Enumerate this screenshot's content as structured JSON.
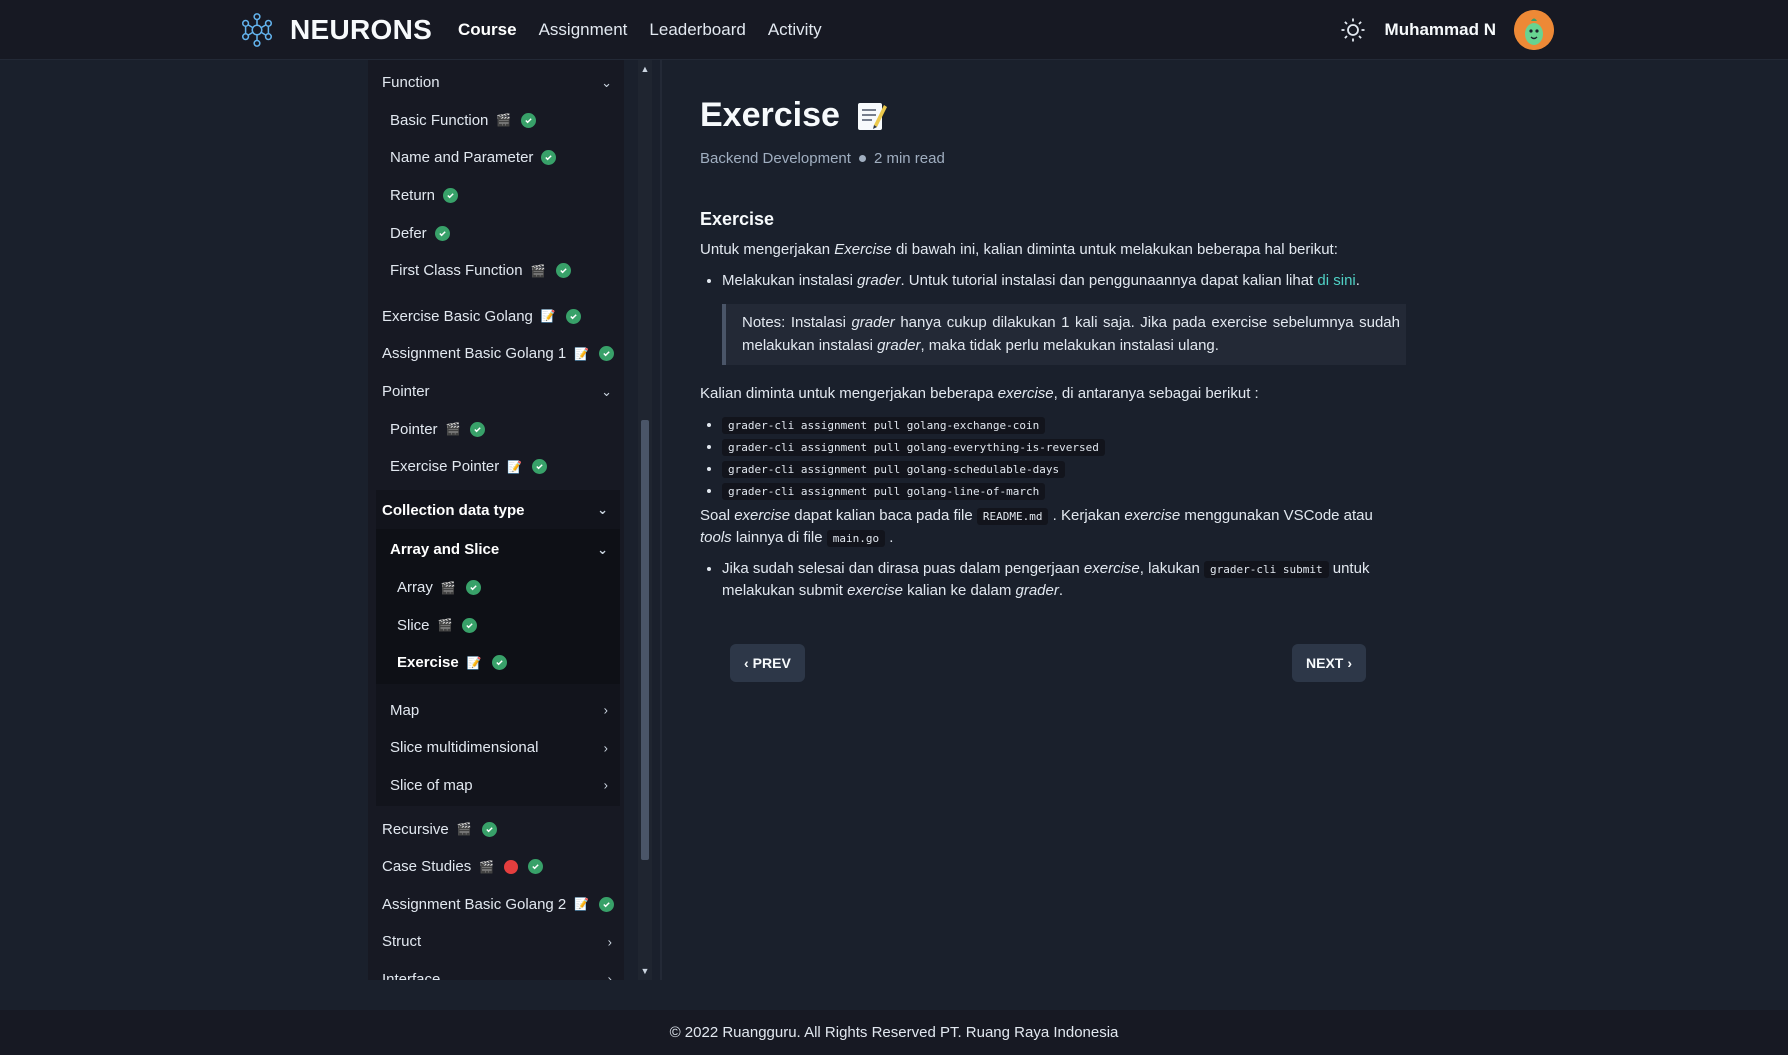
{
  "navbar": {
    "brand": "NEURONS",
    "links": [
      "Course",
      "Assignment",
      "Leaderboard",
      "Activity"
    ],
    "user_name": "Muhammad N"
  },
  "sidebar": {
    "function_section": {
      "label": "Function",
      "items": [
        "Basic Function",
        "Name and Parameter",
        "Return",
        "Defer",
        "First Class Function"
      ]
    },
    "exercise_basic_golang": "Exercise Basic Golang",
    "assignment_basic_golang_1": "Assignment Basic Golang 1",
    "pointer_section": {
      "label": "Pointer",
      "items": [
        "Pointer",
        "Exercise Pointer"
      ]
    },
    "collection_section": {
      "label": "Collection data type",
      "array_and_slice": {
        "label": "Array and Slice",
        "items": [
          "Array",
          "Slice",
          "Exercise"
        ]
      },
      "others": [
        "Map",
        "Slice multidimensional",
        "Slice of map"
      ]
    },
    "recursive": "Recursive",
    "case_studies": "Case Studies",
    "assignment_basic_golang_2": "Assignment Basic Golang 2",
    "struct": "Struct",
    "interface": "Interface"
  },
  "article": {
    "title": "Exercise",
    "category": "Backend Development",
    "read_time": "2 min read",
    "heading": "Exercise",
    "intro_1": "Untuk mengerjakan ",
    "intro_em": "Exercise",
    "intro_2": " di bawah ini, kalian diminta untuk melakukan beberapa hal berikut:",
    "bullet1_1": "Melakukan instalasi ",
    "bullet1_em": "grader",
    "bullet1_2": ". Untuk tutorial instalasi dan penggunaannya dapat kalian lihat ",
    "bullet1_link": "di sini",
    "bullet1_3": ".",
    "notes_1": "Notes: Instalasi ",
    "notes_em1": "grader",
    "notes_2": " hanya cukup dilakukan 1 kali saja. Jika pada exercise sebelumnya sudah melakukan instalasi ",
    "notes_em2": "grader",
    "notes_3": ", maka tidak perlu melakukan instalasi ulang.",
    "list_intro_1": "Kalian diminta untuk mengerjakan beberapa ",
    "list_intro_em": "exercise",
    "list_intro_2": ", di antaranya sebagai berikut :",
    "commands": [
      "grader-cli assignment pull golang-exchange-coin",
      "grader-cli assignment pull golang-everything-is-reversed",
      "grader-cli assignment pull golang-schedulable-days",
      "grader-cli assignment pull golang-line-of-march"
    ],
    "soal_1": "Soal ",
    "soal_em1": "exercise",
    "soal_2": " dapat kalian baca pada file ",
    "soal_code1": "README.md",
    "soal_3": " . Kerjakan ",
    "soal_em2": "exercise",
    "soal_4": " menggunakan VSCode atau ",
    "soal_em3": "tools",
    "soal_5": " lainnya di file ",
    "soal_code2": "main.go",
    "soal_6": " .",
    "final_1": "Jika sudah selesai dan dirasa puas dalam pengerjaan ",
    "final_em1": "exercise",
    "final_2": ", lakukan ",
    "final_code": "grader-cli submit",
    "final_3": " untuk melakukan submit ",
    "final_em2": "exercise",
    "final_4": " kalian ke dalam ",
    "final_em3": "grader",
    "final_5": ".",
    "prev_label": "PREV",
    "next_label": "NEXT"
  },
  "footer": {
    "text": "© 2022 Ruangguru. All Rights Reserved PT. Ruang Raya Indonesia"
  },
  "colors": {
    "check": "#38a169",
    "status_red": "#e53e3e",
    "link": "#4fd1c5",
    "avatar": "#ed8936"
  },
  "icons": [
    "neurons-logo-icon",
    "sun-icon",
    "avatar-icon",
    "video-icon",
    "note-icon",
    "check-circle-icon",
    "chevron-down-icon",
    "chevron-right-icon",
    "chevron-left-icon"
  ]
}
